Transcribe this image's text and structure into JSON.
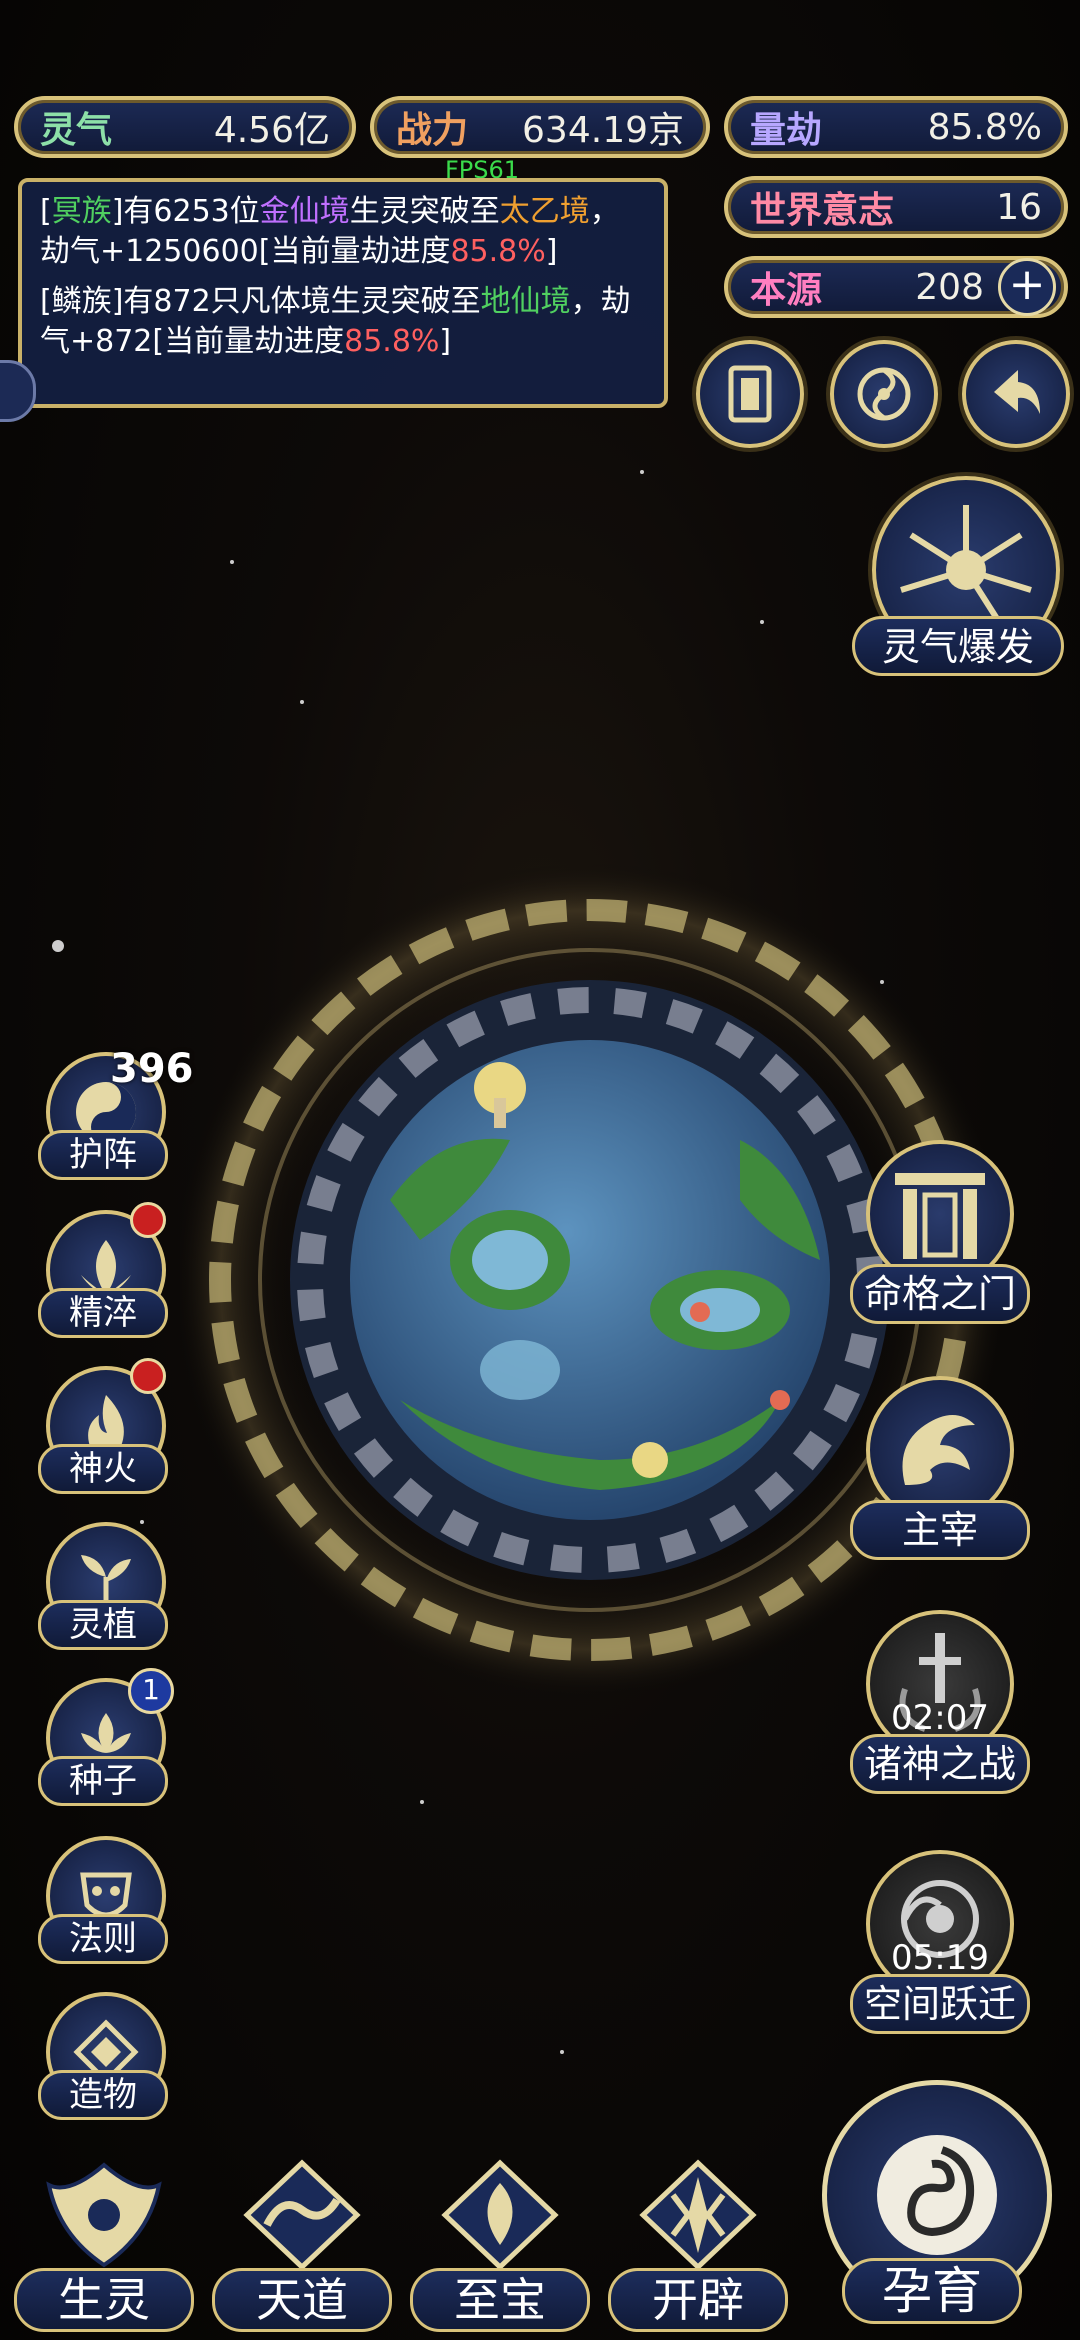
{
  "hud": {
    "fps": "FPS61",
    "stats": {
      "lingqi": {
        "label": "灵气",
        "value": "4.56亿"
      },
      "zhanli": {
        "label": "战力",
        "value": "634.19京"
      },
      "liangjie": {
        "label": "量劫",
        "value": "85.8%"
      },
      "shijie": {
        "label": "世界意志",
        "value": "16"
      },
      "benyuan": {
        "label": "本源",
        "value": "208"
      }
    }
  },
  "log": {
    "m1": {
      "a": "[",
      "race": "冥族",
      "b": "]有6253位",
      "realm": "金仙境",
      "c": "生灵突破至",
      "target": "太乙境",
      "d": "，劫气+1250600[当前量劫进度",
      "pct": "85.8%",
      "e": "]"
    },
    "m2": {
      "a": "[鳞族]有872只凡体境生灵突破至",
      "target": "地仙境",
      "b": "，劫气+872[当前量劫进度",
      "pct": "85.8%",
      "c": "]"
    }
  },
  "left_menu": {
    "huzhen": {
      "label": "护阵",
      "count": "396"
    },
    "jingcui": {
      "label": "精淬"
    },
    "shenhuo": {
      "label": "神火"
    },
    "lingzhi": {
      "label": "灵植"
    },
    "zhongzi": {
      "label": "种子",
      "badge": "1"
    },
    "faze": {
      "label": "法则"
    },
    "zaowu": {
      "label": "造物"
    }
  },
  "right_menu": {
    "burst": {
      "label": "灵气爆发"
    },
    "gate": {
      "label": "命格之门"
    },
    "ruler": {
      "label": "主宰"
    },
    "war": {
      "label": "诸神之战",
      "timer": "02:07"
    },
    "leap": {
      "label": "空间跃迁",
      "timer": "05:19"
    }
  },
  "bottom_nav": {
    "shengling": "生灵",
    "tiandao": "天道",
    "zhibao": "至宝",
    "kaipi": "开辟",
    "yunyu": "孕育"
  },
  "colors": {
    "gold": "#d8c27a",
    "navy": "#1c2a55",
    "ocean": "#3f6f9c",
    "land": "#3f8a3c"
  }
}
